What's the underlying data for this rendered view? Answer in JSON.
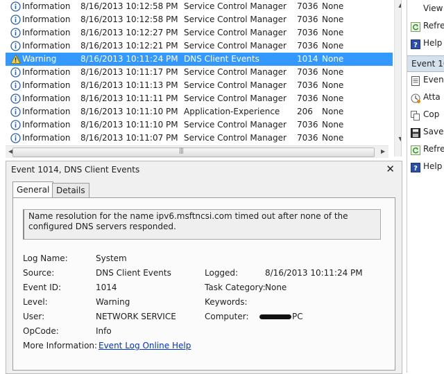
{
  "event_list": {
    "rows": [
      {
        "level": "Information",
        "date": "8/16/2013 10:12:58 PM",
        "source": "Service Control Manager",
        "event_id": "7036",
        "task": "None",
        "icon": "info-icon"
      },
      {
        "level": "Information",
        "date": "8/16/2013 10:12:58 PM",
        "source": "Service Control Manager",
        "event_id": "7036",
        "task": "None",
        "icon": "info-icon"
      },
      {
        "level": "Information",
        "date": "8/16/2013 10:12:27 PM",
        "source": "Service Control Manager",
        "event_id": "7036",
        "task": "None",
        "icon": "info-icon"
      },
      {
        "level": "Information",
        "date": "8/16/2013 10:12:21 PM",
        "source": "Service Control Manager",
        "event_id": "7036",
        "task": "None",
        "icon": "info-icon"
      },
      {
        "level": "Warning",
        "date": "8/16/2013 10:11:24 PM",
        "source": "DNS Client Events",
        "event_id": "1014",
        "task": "None",
        "icon": "warning-icon",
        "selected": true
      },
      {
        "level": "Information",
        "date": "8/16/2013 10:11:17 PM",
        "source": "Service Control Manager",
        "event_id": "7036",
        "task": "None",
        "icon": "info-icon"
      },
      {
        "level": "Information",
        "date": "8/16/2013 10:11:13 PM",
        "source": "Service Control Manager",
        "event_id": "7036",
        "task": "None",
        "icon": "info-icon"
      },
      {
        "level": "Information",
        "date": "8/16/2013 10:11:11 PM",
        "source": "Service Control Manager",
        "event_id": "7036",
        "task": "None",
        "icon": "info-icon"
      },
      {
        "level": "Information",
        "date": "8/16/2013 10:11:10 PM",
        "source": "Application-Experience",
        "event_id": "206",
        "task": "None",
        "icon": "info-icon"
      },
      {
        "level": "Information",
        "date": "8/16/2013 10:11:10 PM",
        "source": "Service Control Manager",
        "event_id": "7036",
        "task": "None",
        "icon": "info-icon"
      },
      {
        "level": "Information",
        "date": "8/16/2013 10:11:07 PM",
        "source": "Service Control Manager",
        "event_id": "7036",
        "task": "None",
        "icon": "info-icon"
      }
    ]
  },
  "detail": {
    "title": "Event 1014, DNS Client Events",
    "tabs": [
      "General",
      "Details"
    ],
    "message": "Name resolution for the name ipv6.msftncsi.com timed out after none of the configured DNS servers responded.",
    "log_name_label": "Log Name:",
    "log_name": "System",
    "source_label": "Source:",
    "source": "DNS Client Events",
    "logged_label": "Logged:",
    "logged": "8/16/2013 10:11:24 PM",
    "event_id_label": "Event ID:",
    "event_id": "1014",
    "task_category_label": "Task Category:",
    "task_category": "None",
    "level_label": "Level:",
    "level": "Warning",
    "keywords_label": "Keywords:",
    "keywords": "",
    "user_label": "User:",
    "user": "NETWORK SERVICE",
    "computer_label": "Computer:",
    "computer_suffix": "PC",
    "opcode_label": "OpCode:",
    "opcode": "Info",
    "more_info_label": "More Information:",
    "more_info_link": "Event Log Online Help"
  },
  "actions": {
    "top_items": [
      {
        "label": "View",
        "icon": "none"
      },
      {
        "label": "Refre",
        "icon": "refresh-icon"
      },
      {
        "label": "Help",
        "icon": "help-icon"
      }
    ],
    "section_header": "Event 101",
    "section_items": [
      {
        "label": "Even",
        "icon": "event-properties-icon"
      },
      {
        "label": "Atta",
        "icon": "attach-task-icon"
      },
      {
        "label": "Cop",
        "icon": "copy-icon"
      },
      {
        "label": "Save",
        "icon": "save-icon"
      },
      {
        "label": "Refre",
        "icon": "refresh-icon"
      },
      {
        "label": "Help",
        "icon": "help-icon"
      }
    ]
  },
  "colors": {
    "selection": "#3399ff",
    "link": "#0033cc",
    "pane_bg": "#f0f0f0",
    "action_header_bg": "#d6e1ee"
  }
}
